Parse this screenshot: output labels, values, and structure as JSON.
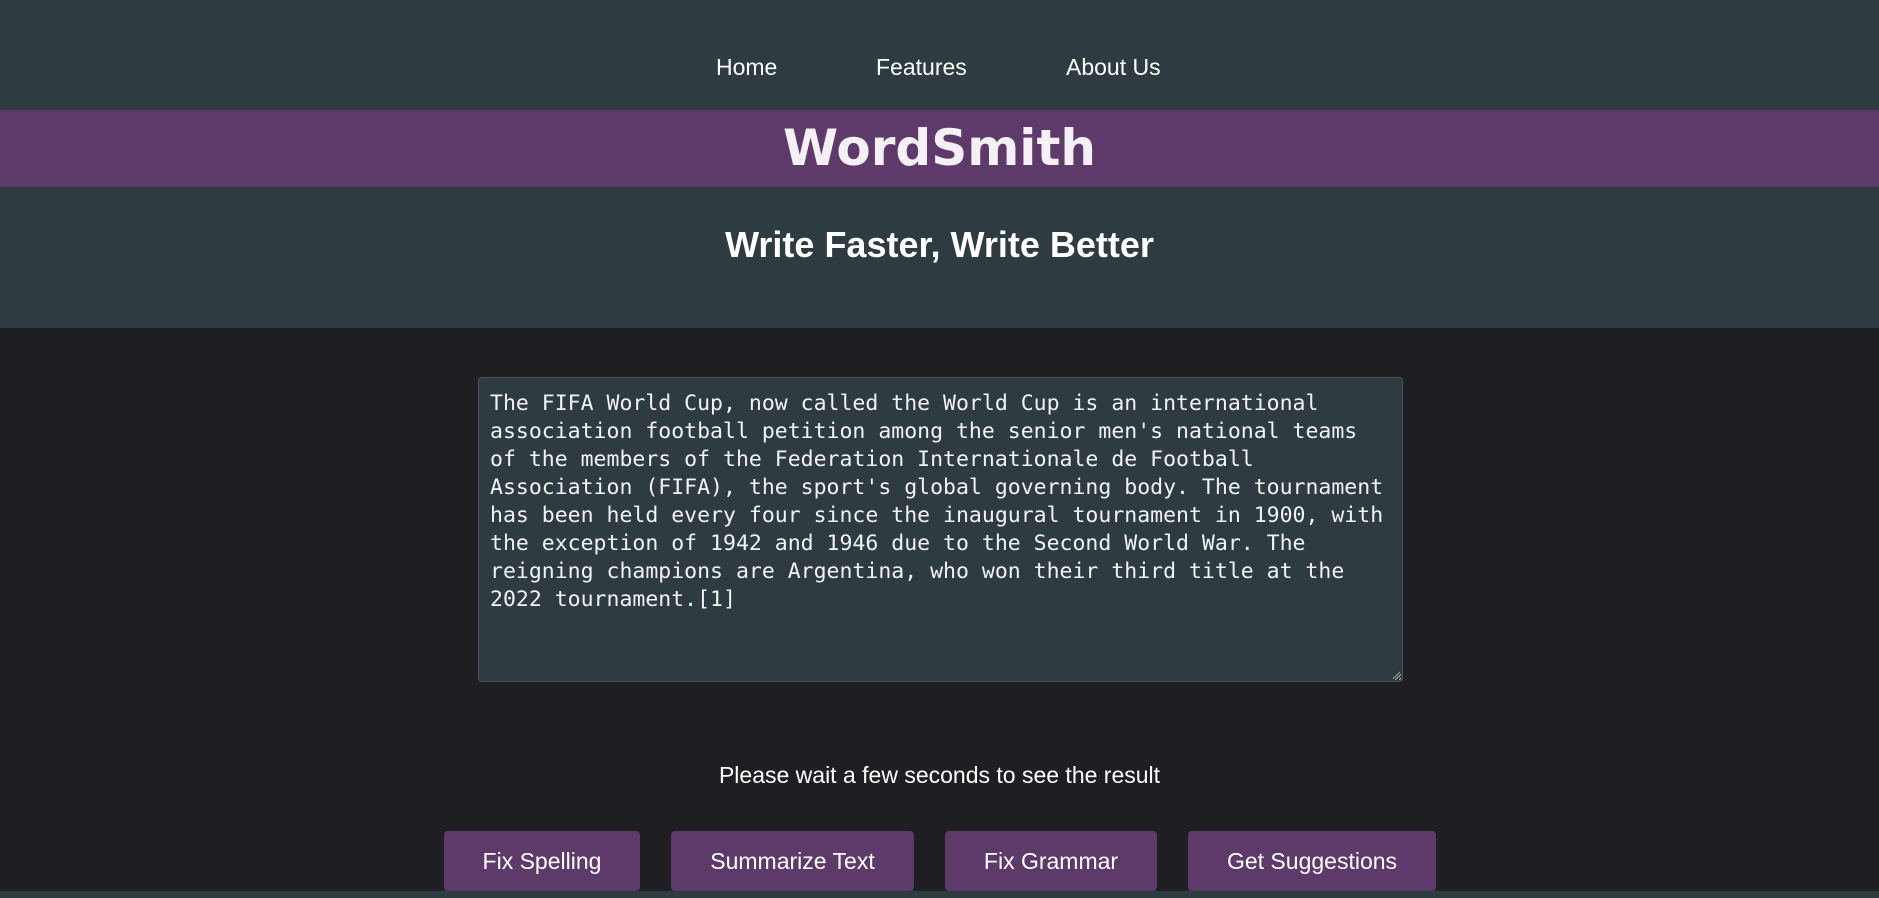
{
  "nav": {
    "items": [
      {
        "label": "Home"
      },
      {
        "label": "Features"
      },
      {
        "label": "About Us"
      }
    ]
  },
  "brand": {
    "name": "WordSmith"
  },
  "hero": {
    "tagline": "Write Faster, Write Better"
  },
  "editor": {
    "value": "The FIFA World Cup, now called the World Cup is an international association football petition among the senior men's national teams of the members of the Federation Internationale de Football Association (FIFA), the sport's global governing body. The tournament has been held every four since the inaugural tournament in 1900, with the exception of 1942 and 1946 due to the Second World War. The reigning champions are Argentina, who won their third title at the 2022 tournament.[1]"
  },
  "status": {
    "message": "Please wait a few seconds to see the result"
  },
  "actions": [
    {
      "label": "Fix Spelling"
    },
    {
      "label": "Summarize Text"
    },
    {
      "label": "Fix Grammar"
    },
    {
      "label": "Get Suggestions"
    }
  ],
  "colors": {
    "page_background": "#1f1e22",
    "header_background": "#2e3b40",
    "accent": "#5e3a6b",
    "text": "#ffffff"
  }
}
